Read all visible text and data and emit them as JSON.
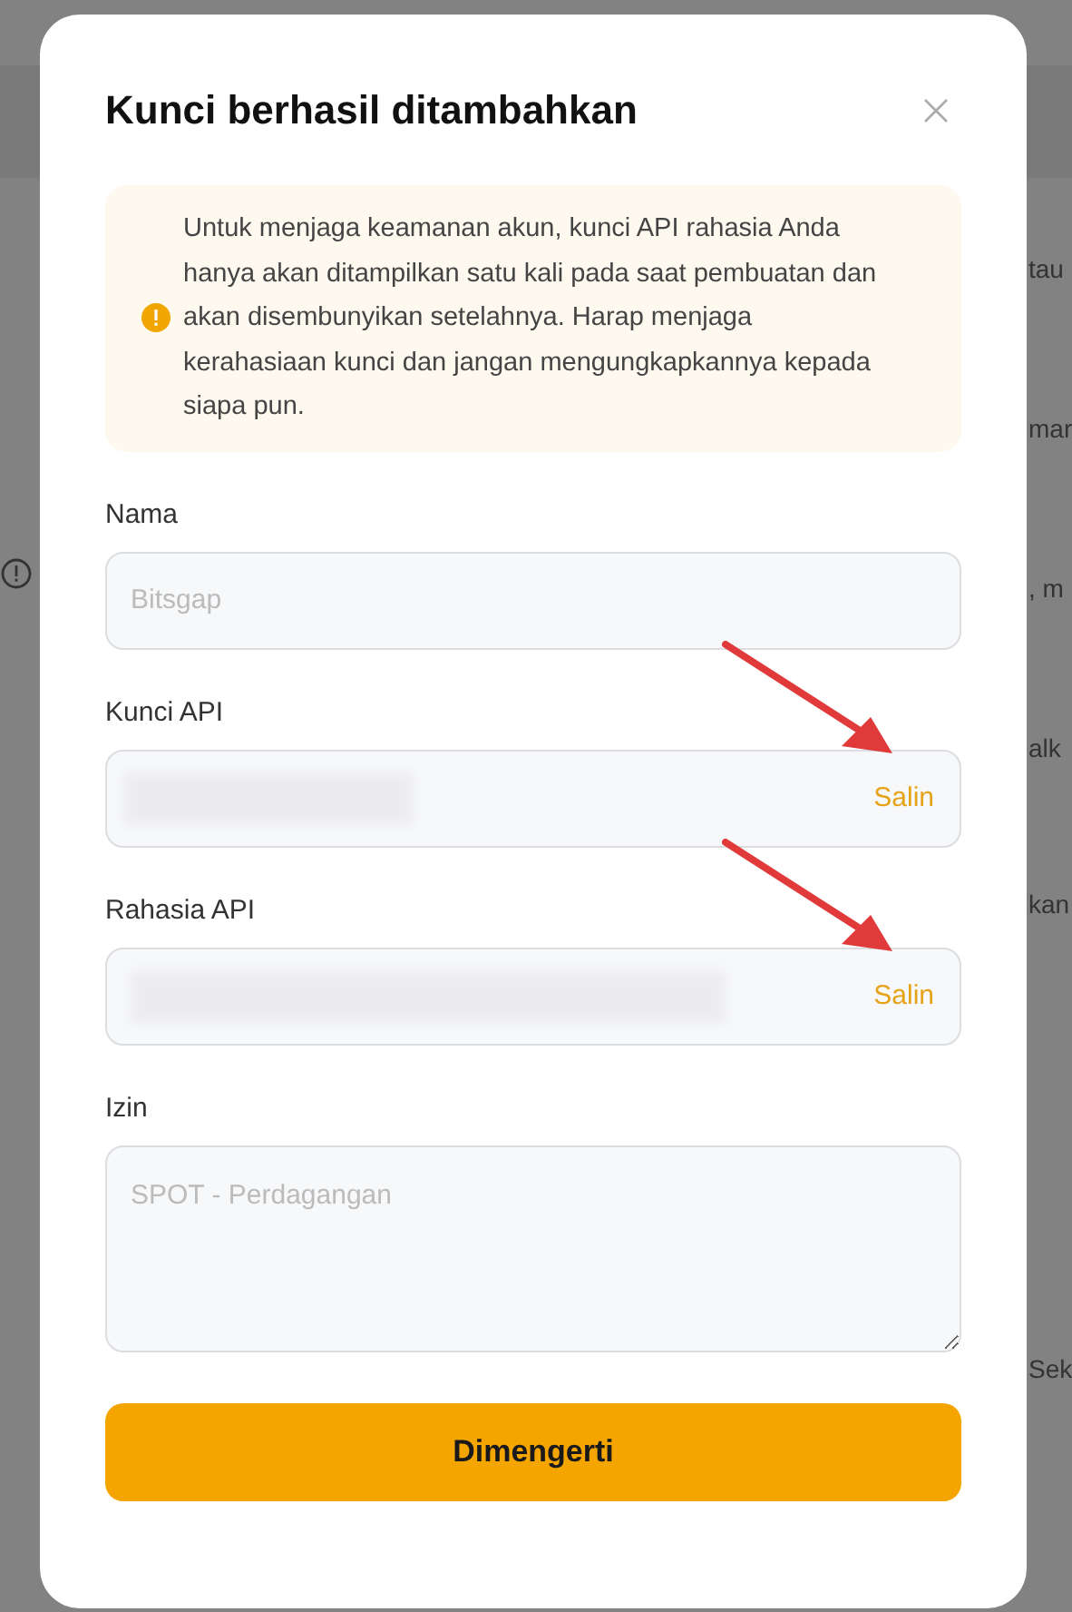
{
  "background": {
    "side_texts": [
      "tau",
      "mar",
      ", m",
      "alk",
      "kan",
      "Sek"
    ]
  },
  "dialog": {
    "title": "Kunci berhasil ditambahkan",
    "notice": "Untuk menjaga keamanan akun, kunci API rahasia Anda hanya akan ditampilkan satu kali pada saat pembuatan dan akan disembunyikan setelahnya. Harap menjaga kerahasiaan kunci dan jangan mengungkapkannya kepada siapa pun.",
    "fields": [
      {
        "kind": "text",
        "label": "Nama",
        "placeholder": "Bitsgap"
      },
      {
        "kind": "secret",
        "label": "Kunci API",
        "action": "Salin"
      },
      {
        "kind": "secret",
        "label": "Rahasia API",
        "action": "Salin"
      },
      {
        "kind": "textarea",
        "label": "Izin",
        "placeholder": "SPOT - Perdagangan"
      }
    ],
    "button": "Dimengerti"
  }
}
